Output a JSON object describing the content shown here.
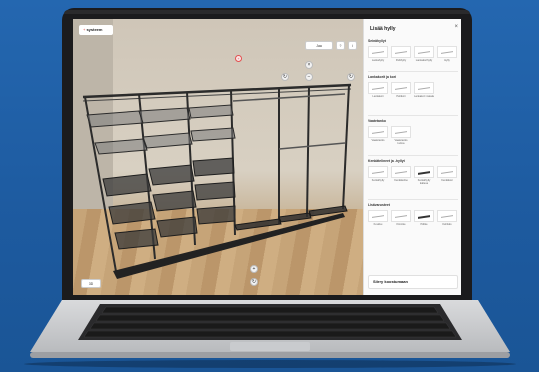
{
  "app": {
    "logo_brand": "+ ",
    "logo_name": "systeem"
  },
  "toolbar": {
    "share_label": "Jaa",
    "help_label": "?",
    "info_label": "i",
    "add_label": "+",
    "rotate_label": "↻",
    "minus_label": "−",
    "plus_label": "+",
    "close_label": "×",
    "bottom_left_label": "3D"
  },
  "sidebar": {
    "title": "Lisää hylly",
    "sections": [
      {
        "title": "Seinähyllyt",
        "items": [
          "Lankahylly",
          "Peltihylly",
          "Lankakorihylly",
          "Hylly"
        ]
      },
      {
        "title": "Lankakorit ja kori",
        "items": [
          "Lankakori",
          "Peltikori",
          "Lankakori matala"
        ]
      },
      {
        "title": "Vaatetanko",
        "items": [
          "Vaatetanko",
          "Vaatetanko kulma"
        ]
      },
      {
        "title": "Kenkätelineet ja -hyllyt",
        "items": [
          "Kenkähylly",
          "Kenkäteline",
          "Kenkähylly kalteva",
          "Kenkäkori"
        ]
      },
      {
        "title": "Lisävarusteet",
        "items": [
          "Koukku",
          "Kiinnike",
          "Pidike",
          "Kehikko"
        ]
      }
    ],
    "footer_label": "Siirry koostumaan"
  },
  "colors": {
    "background": "#1f5fa6",
    "laptop_body": "#1b1b1d",
    "accent_red": "#e23b3b",
    "shelf_metal": "#2b2b2b"
  }
}
